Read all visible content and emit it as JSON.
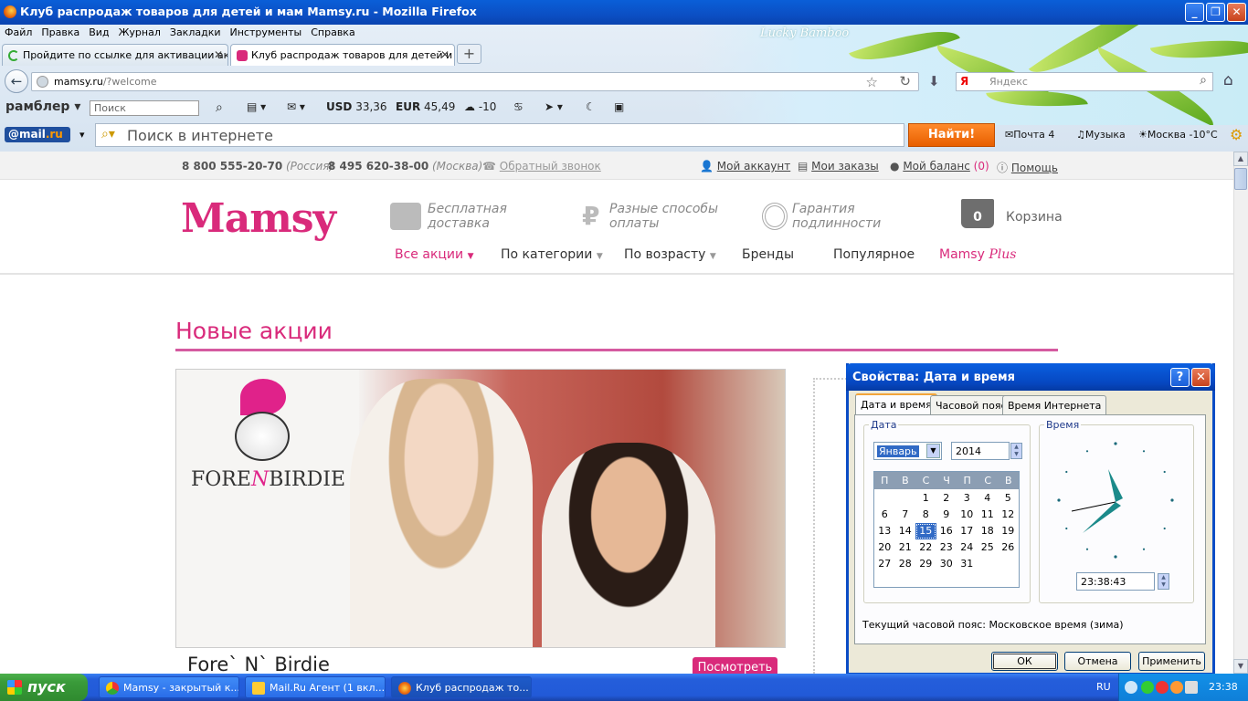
{
  "window": {
    "title": "Клуб распродаж товаров для детей и мам Mamsy.ru - Mozilla Firefox",
    "minimize": "_",
    "maximize": "❐",
    "close": "✕",
    "theme_text": "Lucky Bamboo"
  },
  "menubar": [
    "Файл",
    "Правка",
    "Вид",
    "Журнал",
    "Закладки",
    "Инструменты",
    "Справка"
  ],
  "tabs": [
    {
      "label": "Пройдите по ссылке для активации ак...",
      "close": "✕"
    },
    {
      "label": "Клуб распродаж товаров для детей и ...",
      "close": "✕"
    }
  ],
  "newtab": "+",
  "navbar": {
    "back": "←",
    "url_host": "mamsy.ru",
    "url_path": "/?welcome",
    "star": "☆",
    "reload": "↻",
    "download": "⬇",
    "search_engine": "Я",
    "search_placeholder": "Яндекс",
    "search_icon": "⌕",
    "home": "⌂"
  },
  "rambler": {
    "logo": "рамблер",
    "search_placeholder": "Поиск",
    "usd_label": "USD",
    "usd": "33,36",
    "eur_label": "EUR",
    "eur": "45,49",
    "temp": "-10"
  },
  "mailru": {
    "logo_at": "@",
    "logo_text": "mail",
    "logo_tld": ".ru",
    "search_placeholder": "Поиск в интернете",
    "find_button": "Найти!",
    "mail_label": "Почта",
    "mail_count": "4",
    "music": "Музыка",
    "weather": "Москва -10°C"
  },
  "site": {
    "phone1": "8 800 555-20-70",
    "phone1_region": "(Россия)",
    "phone2": "8 495 620-38-00",
    "phone2_region": "(Москва)",
    "callback": "Обратный звонок",
    "account": "Мой аккаунт",
    "orders": "Мои заказы",
    "balance": "Мой баланс",
    "balance_value": "(0)",
    "help": "Помощь",
    "logo": "Mamsy",
    "features": [
      {
        "line1": "Бесплатная",
        "line2": "доставка"
      },
      {
        "line1": "Разные способы",
        "line2": "оплаты"
      },
      {
        "line1": "Гарантия",
        "line2": "подлинности"
      }
    ],
    "cart_count": "0",
    "cart_label": "Корзина",
    "nav": [
      "Все акции",
      "По категории",
      "По возрасту",
      "Бренды",
      "Популярное",
      "Mamsy",
      "Plus"
    ],
    "section_title": "Новые акции",
    "banner_brand_logo_1": "FORE",
    "banner_brand_logo_2": "N",
    "banner_brand_logo_3": "BIRDIE",
    "brand_name": "Fore` N` Birdie",
    "view_button": "Посмотреть"
  },
  "dialog": {
    "title": "Свойства: Дата и время",
    "help_button": "?",
    "close_button": "✕",
    "tabs": [
      "Дата и время",
      "Часовой пояс",
      "Время Интернета"
    ],
    "date_group": "Дата",
    "month": "Январь",
    "year": "2014",
    "weekdays": [
      "П",
      "В",
      "С",
      "Ч",
      "П",
      "С",
      "В"
    ],
    "days": [
      "",
      "",
      "1",
      "2",
      "3",
      "4",
      "5",
      "6",
      "7",
      "8",
      "9",
      "10",
      "11",
      "12",
      "13",
      "14",
      "15",
      "16",
      "17",
      "18",
      "19",
      "20",
      "21",
      "22",
      "23",
      "24",
      "25",
      "26",
      "27",
      "28",
      "29",
      "30",
      "31"
    ],
    "selected_day": "15",
    "time_group": "Время",
    "time": "23:38:43",
    "timezone_text": "Текущий часовой пояс: Московское время (зима)",
    "ok": "ОК",
    "cancel": "Отмена",
    "apply": "Применить"
  },
  "taskbar": {
    "start": "пуск",
    "tasks": [
      "Mamsy - закрытый к...",
      "Mail.Ru Агент (1 вкл...",
      "Клуб распродаж то..."
    ],
    "lang": "RU",
    "clock": "23:38"
  }
}
